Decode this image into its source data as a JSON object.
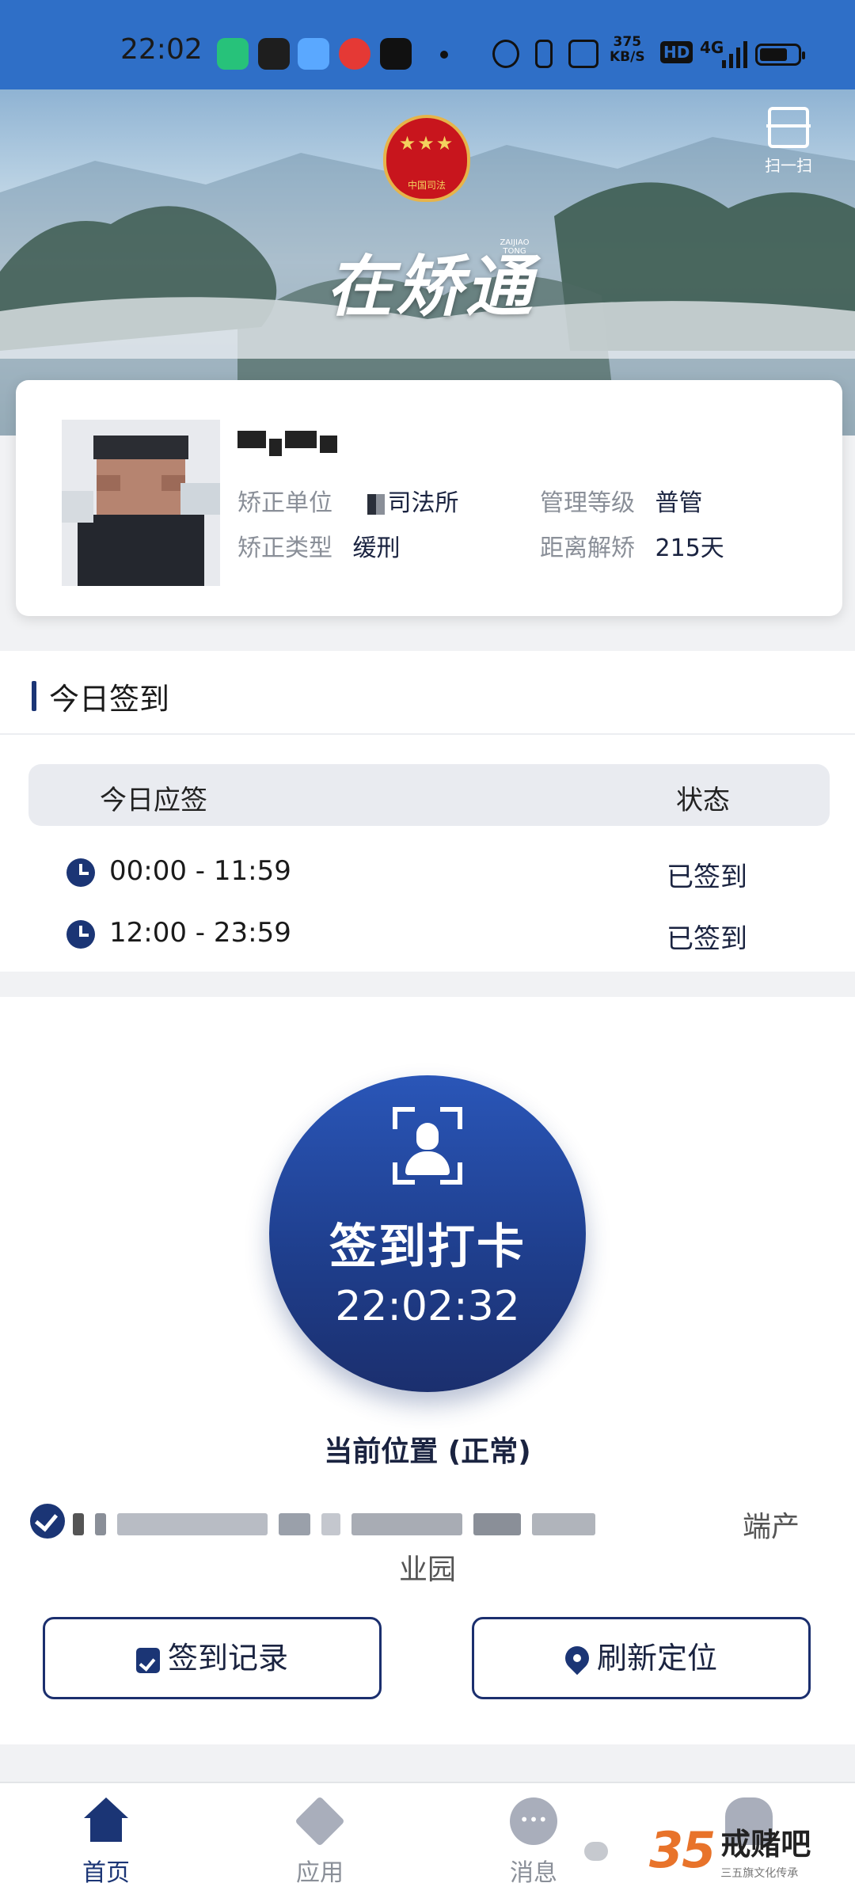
{
  "status_bar": {
    "time": "22:02",
    "network_speed_value": "375",
    "network_speed_unit": "KB/S",
    "hd": "HD",
    "signal": "4G"
  },
  "header": {
    "scan_label": "扫一扫",
    "emblem_text": "中国司法",
    "logo_text": "在矫通",
    "logo_subtext": "ZAIJIAO TONG"
  },
  "profile": {
    "unit_label": "矫正单位",
    "unit_value": "司法所",
    "level_label": "管理等级",
    "level_value": "普管",
    "type_label": "矫正类型",
    "type_value": "缓刑",
    "days_label": "距离解矫",
    "days_value": "215天"
  },
  "today": {
    "title": "今日签到",
    "col_time": "今日应签",
    "col_status": "状态",
    "rows": [
      {
        "time": "00:00 - 11:59",
        "status": "已签到"
      },
      {
        "time": "12:00 - 23:59",
        "status": "已签到"
      }
    ]
  },
  "checkin": {
    "button_label": "签到打卡",
    "clock": "22:02:32",
    "location_status": "当前位置 (正常)",
    "address_tail": "端产",
    "address_line2": "业园",
    "records_button": "签到记录",
    "refresh_button": "刷新定位"
  },
  "tabbar": {
    "home": "首页",
    "apps": "应用",
    "messages": "消息"
  },
  "watermark": {
    "number": "35",
    "title": "戒赌吧",
    "subtitle": "三五旗文化传承"
  },
  "colors": {
    "status_bar": "#2f6fc7",
    "primary_navy": "#1b3575",
    "background": "#f1f2f4"
  }
}
